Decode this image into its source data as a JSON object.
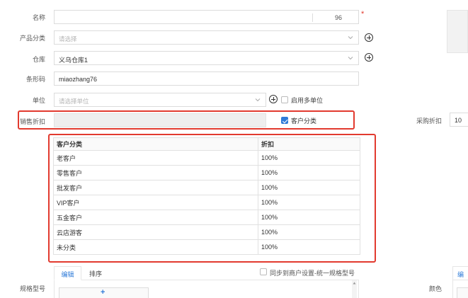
{
  "form": {
    "name": {
      "label": "名称",
      "counter": "96",
      "required_mark": "*"
    },
    "category": {
      "label": "产品分类",
      "placeholder": "请选择"
    },
    "warehouse": {
      "label": "仓库",
      "value": "义乌仓库1"
    },
    "barcode": {
      "label": "条形码",
      "value": "miaozhang76"
    },
    "unit": {
      "label": "单位",
      "placeholder": "请选择单位",
      "multi_unit_label": "启用多单位"
    },
    "sales_discount": {
      "label": "销售折扣",
      "customer_category_label": "客户分类"
    },
    "purchase_discount": {
      "label": "采购折扣",
      "value": "10"
    },
    "spec_model": {
      "label": "规格型号"
    },
    "color": {
      "label": "颜色"
    }
  },
  "discount_table": {
    "headers": [
      "客户分类",
      "折扣"
    ],
    "rows": [
      [
        "老客户",
        "100%"
      ],
      [
        "零售客户",
        "100%"
      ],
      [
        "批发客户",
        "100%"
      ],
      [
        "VIP客户",
        "100%"
      ],
      [
        "五金客户",
        "100%"
      ],
      [
        "云店游客",
        "100%"
      ],
      [
        "未分类",
        "100%"
      ]
    ]
  },
  "spec_tabs": {
    "edit": "编辑",
    "sort": "排序",
    "sync_label": "同步到商户设置-统一规格型号",
    "add_symbol": "+"
  },
  "right_edge": {
    "tab_fragment": "编"
  },
  "colors": {
    "accent": "#2f7bd8",
    "highlight": "#e23a2f"
  }
}
